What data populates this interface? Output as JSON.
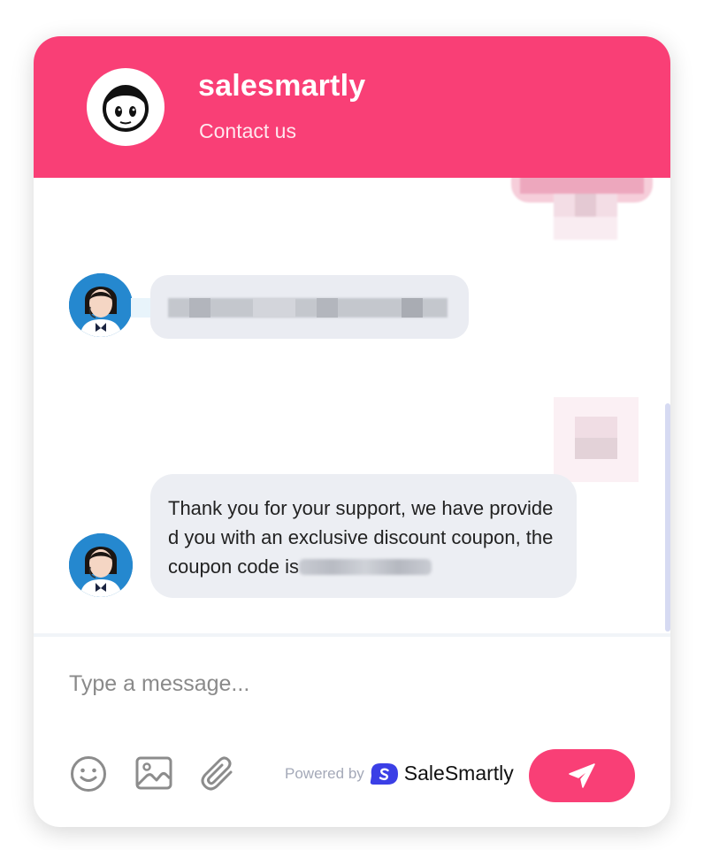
{
  "header": {
    "title": "salesmartly",
    "subtitle": "Contact us",
    "avatar_icon": "cartoon-face-icon"
  },
  "messages": [
    {
      "from": "visitor",
      "text": "",
      "redacted": true
    },
    {
      "from": "agent",
      "text": "",
      "redacted": true
    },
    {
      "from": "visitor",
      "text": "",
      "redacted": true
    },
    {
      "from": "agent",
      "text": "Thank you for your support, we have provided you with an exclusive discount coupon, the coupon code is",
      "redacted_suffix": true
    }
  ],
  "composer": {
    "placeholder": "Type a message...",
    "emoji_icon": "smiley-icon",
    "image_icon": "image-icon",
    "attach_icon": "paperclip-icon",
    "send_icon": "paper-plane-icon"
  },
  "footer": {
    "powered_label": "Powered by",
    "brand_name": "SaleSmartly"
  },
  "colors": {
    "brand": "#f93f76",
    "bubble": "#eceef3",
    "brand_logo": "#3b3fe6"
  }
}
